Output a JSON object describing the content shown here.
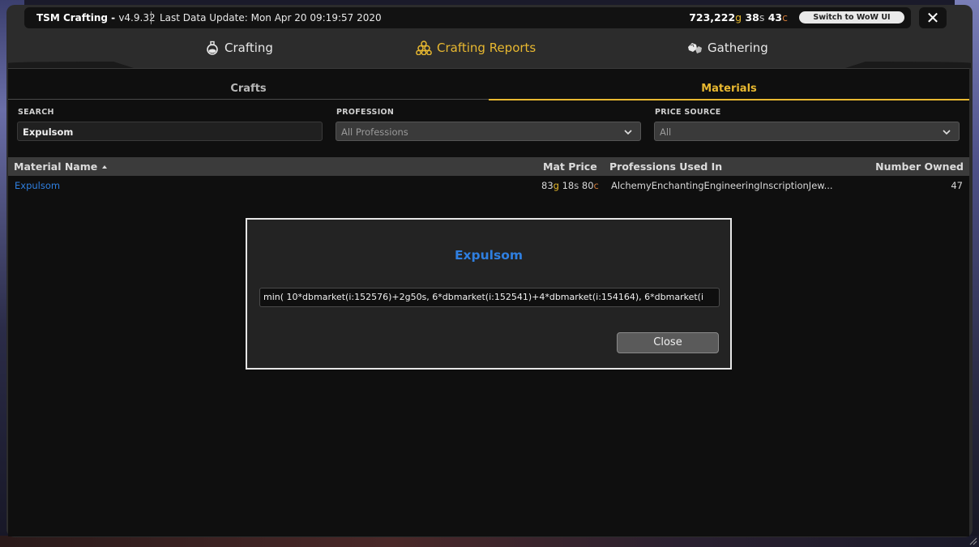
{
  "titlebar": {
    "app_name": "TSM Crafting - ",
    "version": "v4.9.32",
    "last_update": "Last Data Update: Mon Apr 20 09:19:57 2020",
    "gold": "723,222",
    "gold_unit": "g",
    "silver": "38",
    "silver_unit": "s",
    "copper": "43",
    "copper_unit": "c",
    "switch_button": "Switch to WoW UI",
    "close_icon": "✕"
  },
  "tabs": [
    {
      "label": "Crafting",
      "icon": "flask-icon",
      "active": false
    },
    {
      "label": "Crafting Reports",
      "icon": "coins-stack-icon",
      "active": true
    },
    {
      "label": "Gathering",
      "icon": "ore-icon",
      "active": false
    }
  ],
  "subtabs": [
    {
      "label": "Crafts",
      "active": false
    },
    {
      "label": "Materials",
      "active": true
    }
  ],
  "filters": {
    "search_label": "SEARCH",
    "search_value": "Expulsom",
    "profession_label": "PROFESSION",
    "profession_value": "All Professions",
    "price_source_label": "PRICE SOURCE",
    "price_source_value": "All"
  },
  "table": {
    "columns": [
      "Material Name",
      "Mat Price",
      "Professions Used In",
      "Number Owned"
    ],
    "rows": [
      {
        "name": "Expulsom",
        "price_gold": "83",
        "price_silver": "18",
        "price_copper": "80",
        "professions": "AlchemyEnchantingEngineeringInscriptionJew...",
        "owned": "47"
      }
    ]
  },
  "modal": {
    "title": "Expulsom",
    "price_string": "min( 10*dbmarket(i:152576)+2g50s, 6*dbmarket(i:152541)+4*dbmarket(i:154164), 6*dbmarket(i",
    "close_button": "Close"
  },
  "colors": {
    "accent_gold": "#e8b830",
    "link_blue": "#2f7fe0",
    "copper": "#d27c3a",
    "silver": "#c7c7c7"
  }
}
